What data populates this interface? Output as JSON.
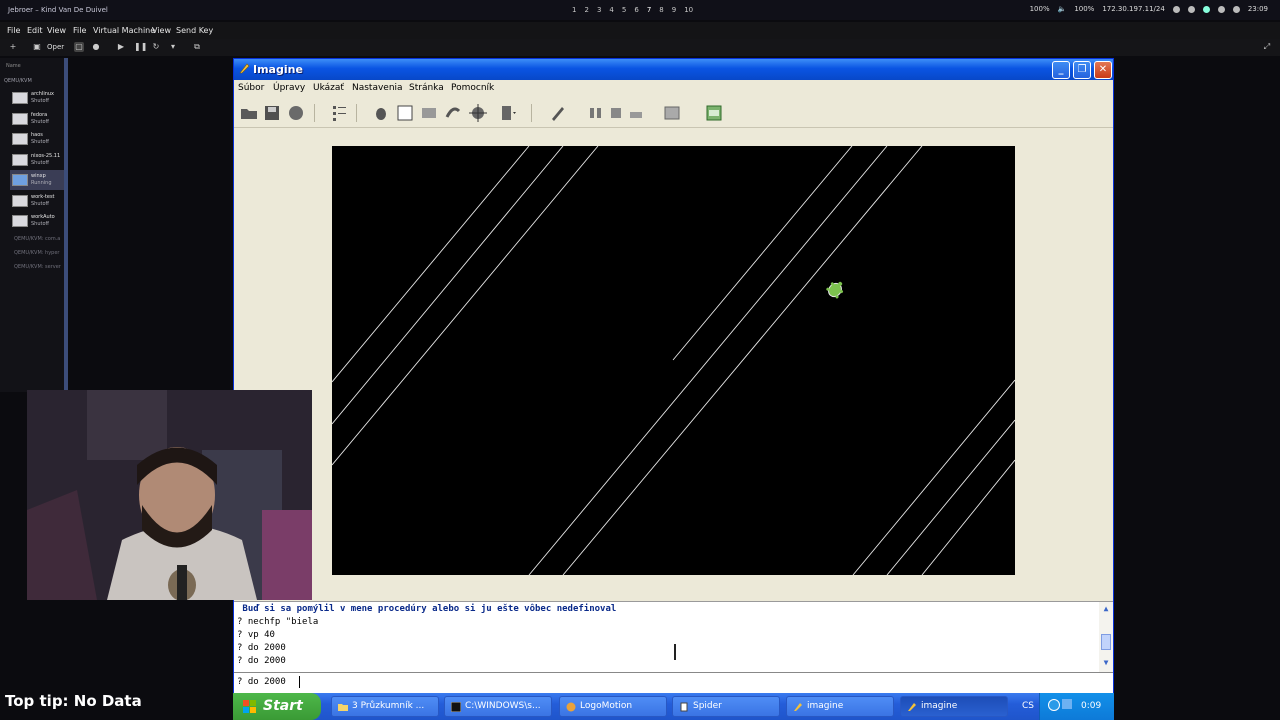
{
  "host": {
    "window_title": "Jebroer – Kind Van De Duivel",
    "workspaces": [
      "1",
      "2",
      "3",
      "4",
      "5",
      "6",
      "7",
      "8",
      "9",
      "10"
    ],
    "active_workspace": "7",
    "tray": {
      "brightness": "100%",
      "volume": "100%",
      "ip": "172.30.197.11/24",
      "clock": "23:09"
    }
  },
  "virt_manager": {
    "menu": [
      "File",
      "Edit",
      "View"
    ],
    "open_label": "Oper",
    "section_label": "Name",
    "group": "QEMU/KVM",
    "vms": [
      {
        "name": "archlinux",
        "state": "Shutoff"
      },
      {
        "name": "fedora",
        "state": "Shutoff"
      },
      {
        "name": "haos",
        "state": "Shutoff"
      },
      {
        "name": "nixos-25.11",
        "state": "Shutoff"
      },
      {
        "name": "winxp",
        "state": "Running"
      },
      {
        "name": "work-test",
        "state": "Shutoff"
      },
      {
        "name": "workAuto",
        "state": "Shutoff"
      }
    ],
    "connections": [
      "QEMU/KVM: com.a",
      "QEMU/KVM: hyper",
      "QEMU/KVM: server"
    ]
  },
  "viewer_menu": [
    "File",
    "Virtual Machine",
    "View",
    "Send Key"
  ],
  "imagine": {
    "title": "Imagine",
    "menu": [
      "Súbor",
      "Úpravy",
      "Ukázať",
      "Nastavenia",
      "Stránka",
      "Pomocník"
    ],
    "console": [
      {
        "text": " Buď si sa pomýlil v mene procedúry alebo si ju ešte vôbec nedefinoval",
        "type": "err"
      },
      {
        "text": "? nechfp \"biela",
        "type": "cmd"
      },
      {
        "text": "? vp 40",
        "type": "cmd"
      },
      {
        "text": "? do 2000",
        "type": "cmd"
      },
      {
        "text": "? do 2000",
        "type": "cmd"
      }
    ],
    "input_value": "? do 2000"
  },
  "taskbar": {
    "start_label": "Start",
    "items": [
      {
        "label": "3 Průzkumník ...",
        "active": false
      },
      {
        "label": "C:\\WINDOWS\\s...",
        "active": false
      },
      {
        "label": "LogoMotion",
        "active": false
      },
      {
        "label": "Spider",
        "active": false
      },
      {
        "label": "imagine",
        "active": false
      },
      {
        "label": "imagine",
        "active": true
      }
    ],
    "lang": "CS",
    "clock": "0:09"
  },
  "caption": "Top tip: No Data",
  "colors": {
    "xp_blue": "#0a54e3",
    "canvas": "#000000",
    "taskbar": "#245dd9",
    "start_green": "#3a9a35"
  }
}
